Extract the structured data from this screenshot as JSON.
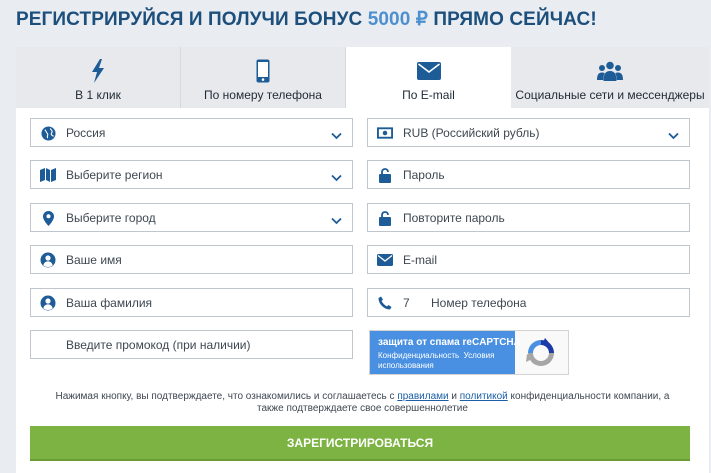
{
  "header": {
    "title_start": "РЕГИСТРИРУЙСЯ И ПОЛУЧИ БОНУС ",
    "title_accent": "5000 ₽",
    "title_end": " ПРЯМО СЕЙЧАС!"
  },
  "tabs": [
    {
      "label": "В 1 клик",
      "icon": "lightning-icon"
    },
    {
      "label": "По номеру телефона",
      "icon": "phone-icon"
    },
    {
      "label": "По E-mail",
      "icon": "envelope-icon",
      "active": true
    },
    {
      "label": "Социальные сети и мессенджеры",
      "icon": "users-icon"
    }
  ],
  "form": {
    "country": "Россия",
    "region": "Выберите регион",
    "city": "Выберите город",
    "first_name": "Ваше имя",
    "last_name": "Ваша фамилия",
    "promo": "Введите промокод (при наличии)",
    "currency": "RUB (Российский рубль)",
    "password": "Пароль",
    "password_repeat": "Повторите пароль",
    "email": "E-mail",
    "phone_prefix": "7",
    "phone": "Номер телефона"
  },
  "captcha": {
    "title": "защита от спама reCAPTCHA",
    "privacy": "Конфиденциальность",
    "terms": "Условия",
    "usage": "использования"
  },
  "consent": {
    "part1": "Нажимая кнопку, вы подтверждаете, что ознакомились и соглашаетесь с ",
    "rules_link": "правилами",
    "and": " и ",
    "policy_link": "политикой",
    "part2": " конфиденциальности компании, а также подтверждаете свое совершеннолетие"
  },
  "submit_label": "ЗАРЕГИСТРИРОВАТЬСЯ",
  "colors": {
    "title": "#1c4f7c",
    "accent": "#4d8fcf",
    "icon": "#1d5c96",
    "submit": "#7cb342",
    "captcha": "#4a90e2"
  }
}
